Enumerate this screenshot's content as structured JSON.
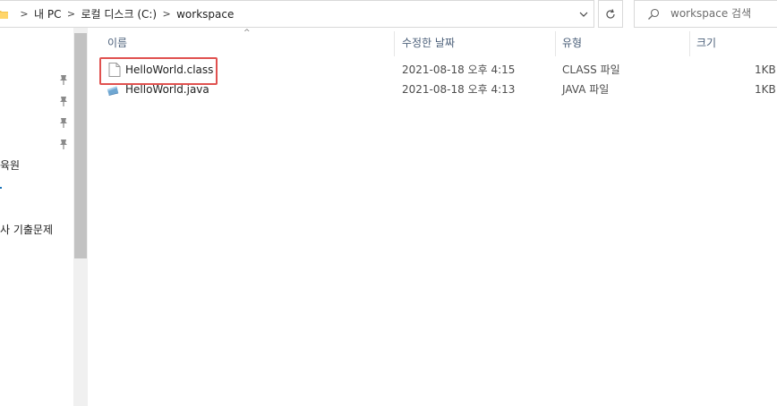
{
  "address_bar": {
    "breadcrumbs": [
      "내 PC",
      "로컬 디스크 (C:)",
      "workspace"
    ],
    "separator": ">",
    "dropdown_glyph": "⌄",
    "refresh_glyph": "↻"
  },
  "search": {
    "placeholder": "workspace 검색"
  },
  "nav_pane": {
    "items": [
      "육원",
      "사 기출문제"
    ]
  },
  "columns": {
    "name": "이름",
    "date": "수정한 날짜",
    "type": "유형",
    "size": "크기",
    "sort_glyph": "^"
  },
  "files": [
    {
      "name": "HelloWorld.class",
      "date": "2021-08-18 오후 4:15",
      "type": "CLASS 파일",
      "size": "1KB",
      "icon": "blank-file-icon",
      "selected_highlight": true
    },
    {
      "name": "HelloWorld.java",
      "date": "2021-08-18 오후 4:13",
      "type": "JAVA 파일",
      "size": "1KB",
      "icon": "java-file-icon",
      "selected_highlight": false
    }
  ],
  "colors": {
    "highlight_border": "#e0514f",
    "header_text": "#4c607a"
  }
}
